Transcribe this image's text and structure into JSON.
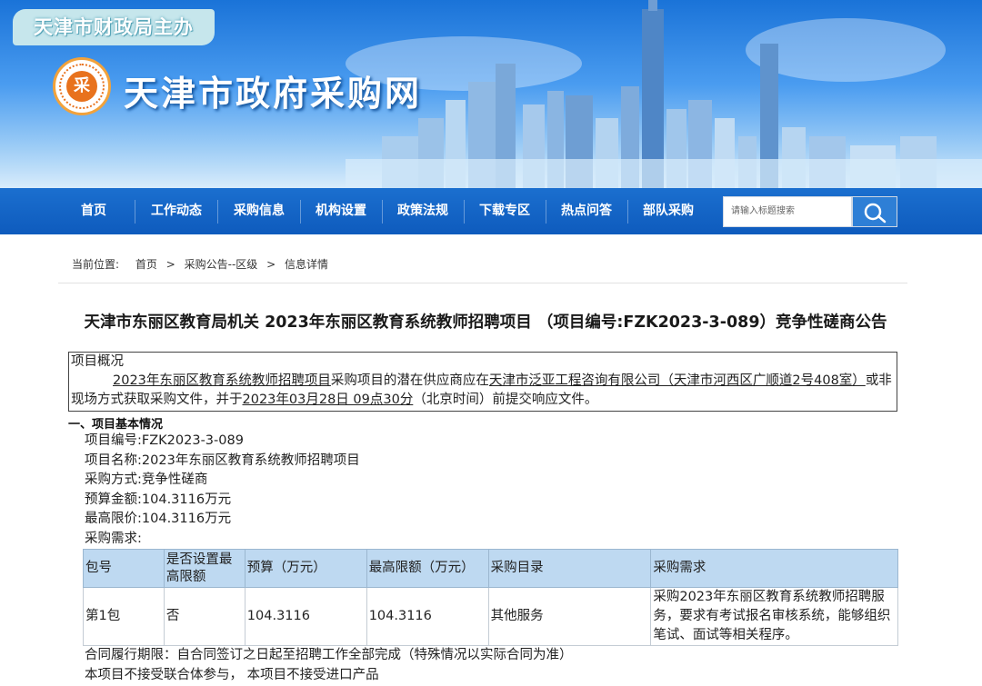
{
  "header": {
    "sponsor": "天津市财政局主办",
    "site_title": "天津市政府采购网",
    "logo_glyph": "采"
  },
  "nav": {
    "items": [
      "首页",
      "工作动态",
      "采购信息",
      "机构设置",
      "政策法规",
      "下载专区",
      "热点问答",
      "部队采购"
    ],
    "search_placeholder": "请输入标题搜索"
  },
  "breadcrumb": {
    "label": "当前位置:",
    "items": [
      "首页",
      "采购公告--区级",
      "信息详情"
    ],
    "separator": ">"
  },
  "article": {
    "title": "天津市东丽区教育局机关 2023年东丽区教育系统教师招聘项目 （项目编号:FZK2023-3-089）竞争性磋商公告",
    "overview": {
      "heading": "项目概况",
      "project_name": "2023年东丽区教育系统教师招聘项目",
      "text1": "采购项目的潜在供应商应在",
      "location": "天津市泛亚工程咨询有限公司（天津市河西区广顺道2号408室）",
      "text2": "或非现场方式获取采购文件，并于",
      "deadline": "2023年03月28日 09点30分",
      "text3": "（北京时间）前提交响应文件。"
    },
    "section1": {
      "heading": "一、项目基本情况",
      "fields": [
        {
          "label": "项目编号:",
          "value": "FZK2023-3-089"
        },
        {
          "label": "项目名称:",
          "value": "2023年东丽区教育系统教师招聘项目"
        },
        {
          "label": "采购方式:",
          "value": "竞争性磋商"
        },
        {
          "label": "预算金额:",
          "value": "104.3116万元"
        },
        {
          "label": "最高限价:",
          "value": "104.3116万元"
        },
        {
          "label": "采购需求:",
          "value": ""
        }
      ],
      "table": {
        "headers": [
          "包号",
          "是否设置最高限额",
          "预算（万元）",
          "最高限额（万元）",
          "采购目录",
          "采购需求"
        ],
        "rows": [
          [
            "第1包",
            "否",
            "104.3116",
            "104.3116",
            "其他服务",
            "采购2023年东丽区教育系统教师招聘服务，要求有考试报名审核系统，能够组织笔试、面试等相关程序。"
          ]
        ]
      },
      "contract_period": "合同履行期限：自合同签订之日起至招聘工作全部完成（特殊情况以实际合同为准）",
      "notes": "本项目不接受联合体参与， 本项目不接受进口产品"
    }
  },
  "colors": {
    "nav_bg": "#0e5bbd",
    "table_header_bg": "#bed9f1",
    "banner_top": "#1a73d8"
  }
}
